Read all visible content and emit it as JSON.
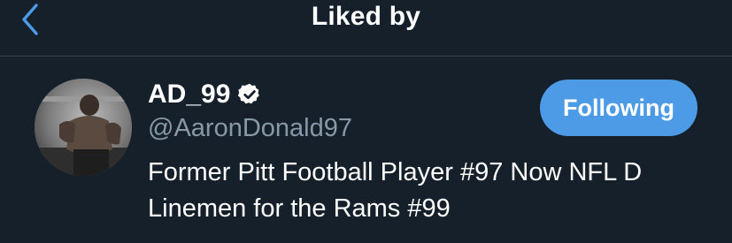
{
  "header": {
    "title": "Liked by",
    "back_icon": "chevron-left-icon"
  },
  "user": {
    "display_name": "AD_99",
    "verified": true,
    "handle": "@AaronDonald97",
    "bio": "Former Pitt Football Player #97 Now NFL D Linemen for the Rams #99",
    "follow_button_label": "Following"
  },
  "colors": {
    "background": "#15202b",
    "accent": "#4d9be6",
    "secondary_text": "#8899a6",
    "divider": "#38444d"
  }
}
